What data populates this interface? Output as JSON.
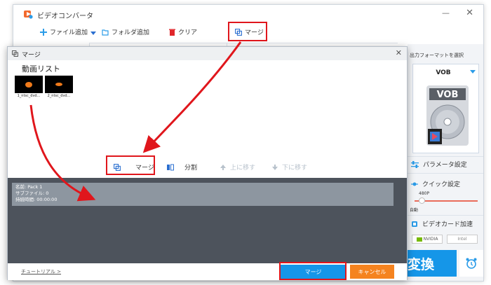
{
  "app": {
    "title": "ビデオコンバータ",
    "controls": {
      "minimize": "—",
      "close": "✕"
    }
  },
  "toolbar": {
    "add_file": "ファイル追加",
    "add_folder": "フォルダ追加",
    "clear": "クリア",
    "merge": "マージ"
  },
  "right_panel": {
    "output_format_label": "出力フォーマットを選択",
    "format_name": "VOB",
    "format_badge": "VOB",
    "parameter_settings": "パラメータ設定",
    "quick_settings": "クイック設定",
    "slider_value": "480P",
    "slider_min_label": "自動",
    "gpu_accel": "ビデオカード加速",
    "gpu_nvidia": "NVIDIA",
    "gpu_intel": "Intel",
    "convert": "変換"
  },
  "dialog": {
    "title": "マージ",
    "close": "✕",
    "list_heading": "動画リスト",
    "thumbnails": [
      {
        "caption": "1_ntsc_dvd..."
      },
      {
        "caption": "2_ntsc_dvd..."
      }
    ],
    "actions": {
      "merge": "マージ",
      "split": "分割",
      "move_up": "上に移す",
      "move_down": "下に移す"
    },
    "pack": {
      "name": "名前: Pack 1",
      "subfiles": "サブファイル: 0",
      "duration": "持続時間: 00:00:00"
    },
    "footer": {
      "tutorial": "チュートリアル >",
      "merge_button": "マージ",
      "cancel_button": "キャンセル"
    }
  },
  "colors": {
    "accent_blue": "#1596e8",
    "cancel_orange": "#f5831f",
    "annotation_red": "#e0161c",
    "pack_area": "#4d535c",
    "pack_row": "#8d96a0"
  }
}
